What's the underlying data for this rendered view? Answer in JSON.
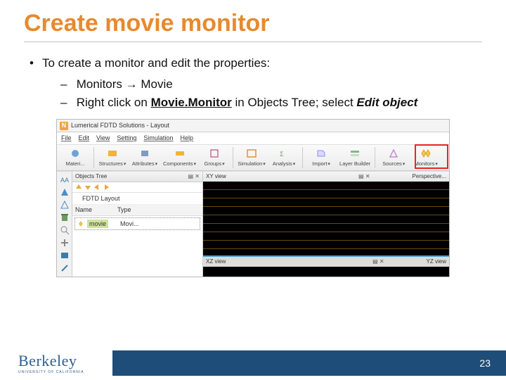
{
  "title": "Create movie monitor",
  "bullets": {
    "lvl1": "To create a monitor and edit the properties:",
    "lvl2a_pre": "Monitors ",
    "lvl2a_arrow": "→",
    "lvl2a_post": " Movie",
    "lvl2b_pre": "Right click on ",
    "lvl2b_mid": "Movie.Monitor",
    "lvl2b_post1": " in Objects Tree; select ",
    "lvl2b_post2": "Edit object"
  },
  "app": {
    "icon_letter": "N",
    "title": "Lumerical FDTD Solutions - Layout",
    "menu": [
      "File",
      "Edit",
      "View",
      "Setting",
      "Simulation",
      "Help"
    ],
    "toolbar": [
      {
        "label": "Materi...",
        "color": "#6fa3d6"
      },
      {
        "label": "Structures",
        "color": "#f2b33a"
      },
      {
        "label": "Attributes",
        "color": "#7d9cc4"
      },
      {
        "label": "Components",
        "color": "#f2b33a"
      },
      {
        "label": "Groups",
        "color": "#c96e9c"
      },
      {
        "label": "Simulation",
        "color": "#6fa3d6"
      },
      {
        "label": "Analysis",
        "color": "#6e9c6e"
      },
      {
        "label": "Import",
        "color": "#8c8cff"
      },
      {
        "label": "Layer Builder",
        "color": "#8bb48b"
      },
      {
        "label": "Sources",
        "color": "#c38bd6"
      },
      {
        "label": "Monitors",
        "color": "#f2b33a"
      }
    ],
    "tree": {
      "pane_title": "Objects Tree",
      "root": "FDTD Layout",
      "col_name": "Name",
      "col_type": "Type",
      "row_name": "movie",
      "row_type": "Movi..."
    },
    "views": {
      "top_label": "XY view",
      "persp_label": "Perspective...",
      "bot_label": "XZ view",
      "bot2_label": "YZ view"
    }
  },
  "footer": {
    "logo": "Berkeley",
    "logo_sub": "UNIVERSITY OF CALIFORNIA",
    "page": "23"
  }
}
